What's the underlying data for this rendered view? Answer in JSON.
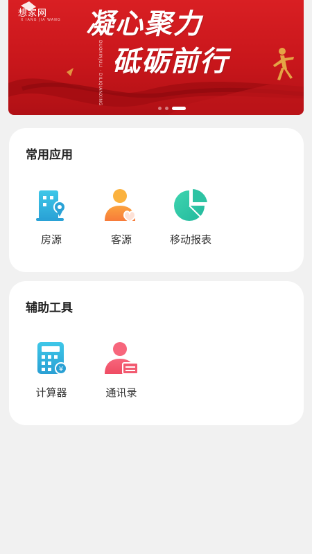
{
  "banner": {
    "logo_text": "想家网",
    "logo_sub": "X IANG JIA WANG",
    "slogan_line1": "凝心聚力",
    "slogan_line2": "砥砺前行",
    "vertical_text": "DUOXINJULI · DILIQIANXING",
    "colors": {
      "bg": "#d91f23",
      "ribbon": "#a30d12"
    },
    "carousel": {
      "count": 3,
      "active_index": 2
    }
  },
  "common_apps": {
    "title": "常用应用",
    "items": [
      {
        "label": "房源",
        "icon": "building-location-icon"
      },
      {
        "label": "客源",
        "icon": "person-heart-icon"
      },
      {
        "label": "移动报表",
        "icon": "pie-chart-icon"
      }
    ]
  },
  "tools": {
    "title": "辅助工具",
    "items": [
      {
        "label": "计算器",
        "icon": "calculator-icon"
      },
      {
        "label": "通讯录",
        "icon": "contacts-icon"
      }
    ]
  }
}
